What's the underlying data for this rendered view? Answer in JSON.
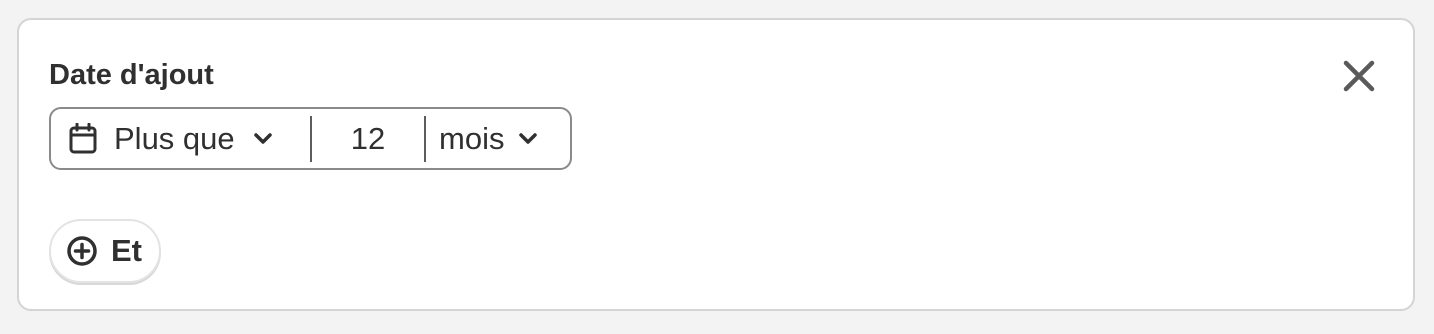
{
  "panel": {
    "title": "Date d'ajout",
    "close_icon": "close-icon"
  },
  "filter": {
    "calendar_icon": "calendar-icon",
    "operator": "Plus que",
    "value": "12",
    "unit": "mois"
  },
  "add_condition": {
    "icon": "plus-circle-icon",
    "label": "Et"
  },
  "colors": {
    "text": "#303030",
    "border": "#8a8a8a",
    "background": "#f3f3f3"
  }
}
